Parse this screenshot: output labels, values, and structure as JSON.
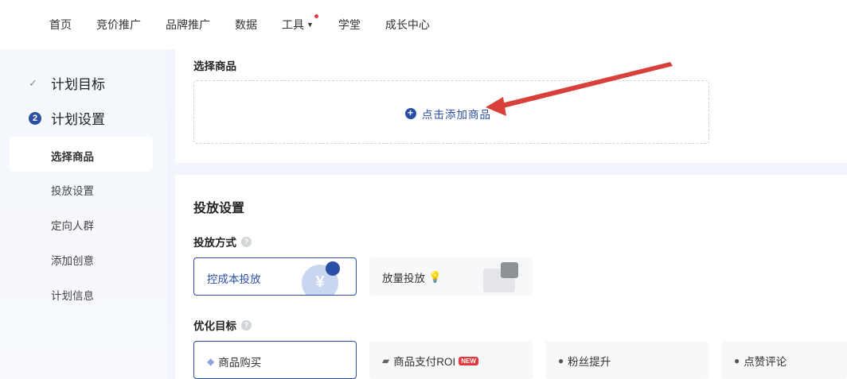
{
  "topnav": {
    "items": [
      {
        "label": "首页"
      },
      {
        "label": "竞价推广"
      },
      {
        "label": "品牌推广"
      },
      {
        "label": "数据"
      },
      {
        "label": "工具"
      },
      {
        "label": "学堂"
      },
      {
        "label": "成长中心"
      }
    ]
  },
  "sidebar": {
    "step1": {
      "label": "计划目标",
      "status": "done"
    },
    "step2": {
      "number": "2",
      "label": "计划设置"
    },
    "sub_items": [
      "选择商品",
      "投放设置",
      "定向人群",
      "添加创意",
      "计划信息"
    ],
    "active_sub": "选择商品"
  },
  "select_product": {
    "title": "选择商品",
    "add_label": "点击添加商品"
  },
  "delivery": {
    "heading": "投放设置",
    "method_label": "投放方式",
    "methods": [
      {
        "label": "控成本投放",
        "selected": true
      },
      {
        "label": "放量投放",
        "selected": false
      }
    ],
    "goal_label": "优化目标",
    "goals": [
      {
        "label": "商品购买",
        "selected": true,
        "icon": "diamond-icon"
      },
      {
        "label": "商品支付ROI",
        "selected": false,
        "icon": "folder-icon",
        "badge": "NEW"
      },
      {
        "label": "粉丝提升",
        "selected": false,
        "icon": "user-icon"
      },
      {
        "label": "点赞评论",
        "selected": false,
        "icon": "chat-icon"
      }
    ]
  },
  "colors": {
    "accent": "#2a4fa4",
    "annotation_arrow": "#d9403a",
    "badge_red": "#e0393e"
  }
}
